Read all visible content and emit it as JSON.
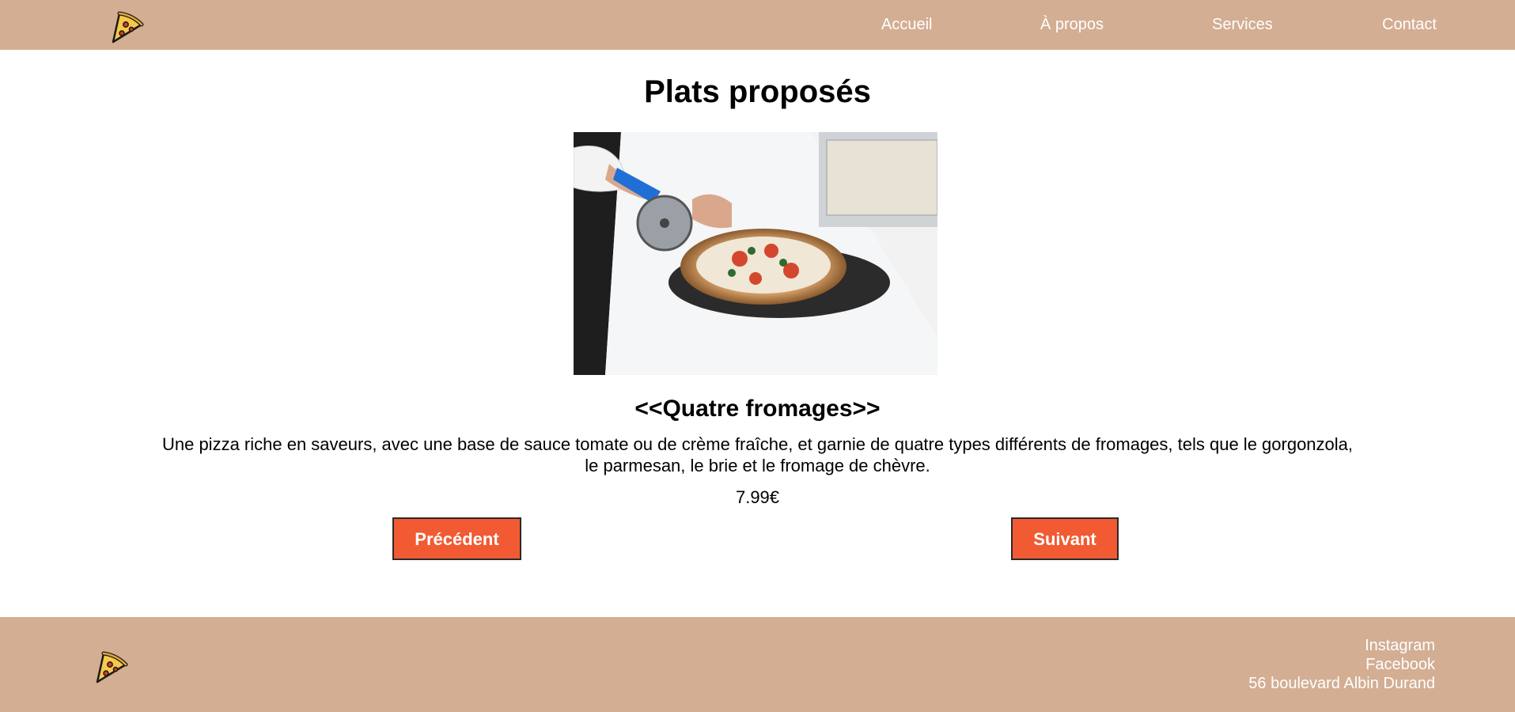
{
  "header": {
    "logo_icon": "pizza-slice-icon",
    "nav": [
      {
        "label": "Accueil"
      },
      {
        "label": "À propos"
      },
      {
        "label": "Services"
      },
      {
        "label": "Contact"
      }
    ]
  },
  "main": {
    "title": "Plats proposés",
    "dish": {
      "name": "<<Quatre fromages>>",
      "description": "Une pizza riche en saveurs, avec une base de sauce tomate ou de crème fraîche, et garnie de quatre types différents de fromages, tels que le gorgonzola, le parmesan, le brie et le fromage de chèvre.",
      "price": "7.99€"
    },
    "buttons": {
      "previous_label": "Précédent",
      "next_label": "Suivant"
    }
  },
  "footer": {
    "logo_icon": "pizza-slice-icon",
    "instagram": "Instagram",
    "facebook": "Facebook",
    "address": "56 boulevard Albin Durand"
  },
  "colors": {
    "header_bg": "#d3ae93",
    "button_bg": "#f15a32",
    "text_light": "#ffffff"
  }
}
